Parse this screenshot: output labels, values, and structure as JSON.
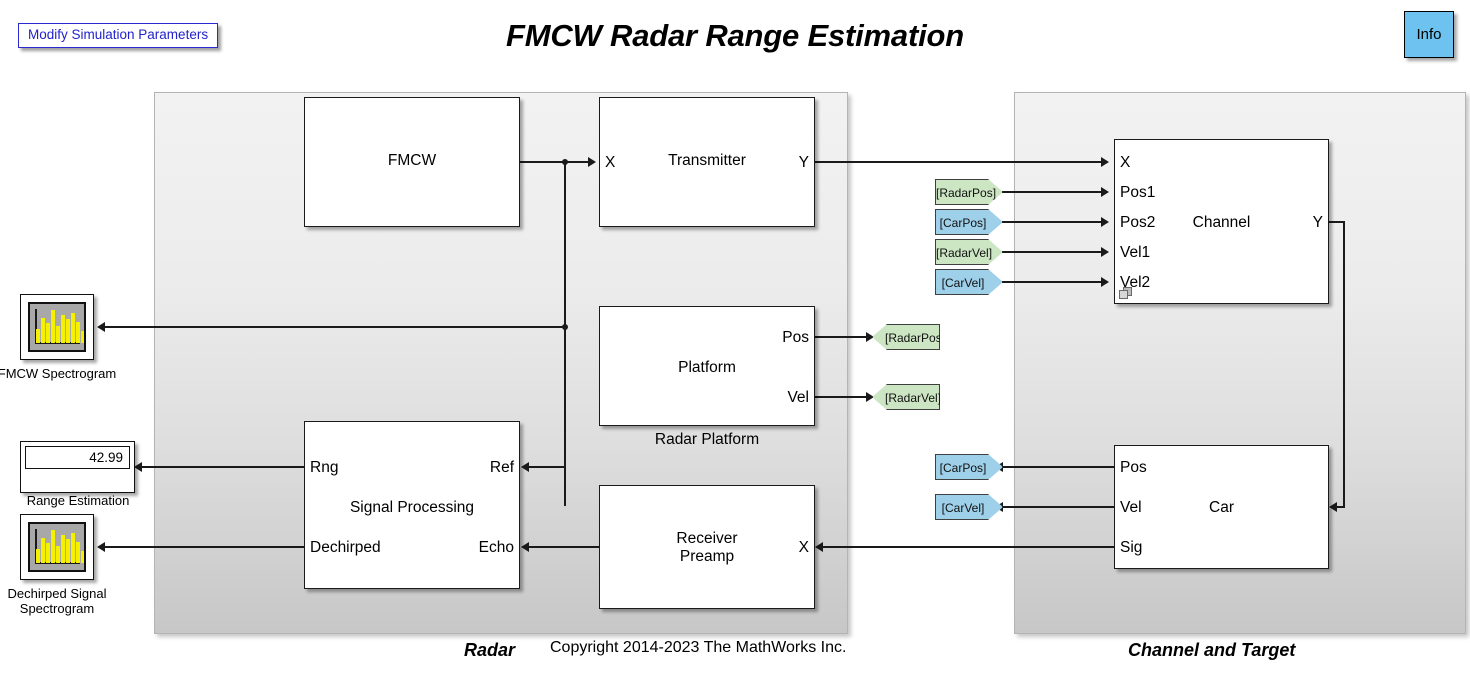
{
  "header": {
    "title": "FMCW Radar Range Estimation",
    "modify_button": "Modify Simulation Parameters",
    "info_button": "Info"
  },
  "footer": {
    "copyright": "Copyright 2014-2023 The MathWorks Inc."
  },
  "subsystems": [
    {
      "label": "Radar"
    },
    {
      "label": "Channel and Target"
    }
  ],
  "radar": {
    "fmcw": {
      "title": "FMCW"
    },
    "transmitter": {
      "title": "Transmitter",
      "in": "X",
      "out": "Y"
    },
    "platform": {
      "title": "Platform",
      "caption": "Radar Platform",
      "out_pos": "Pos",
      "out_vel": "Vel"
    },
    "signal_processing": {
      "title": "Signal Processing",
      "out_rng": "Rng",
      "out_dechirped": "Dechirped",
      "in_ref": "Ref",
      "in_echo": "Echo"
    },
    "receiver": {
      "title": "Receiver\nPreamp",
      "in": "X"
    }
  },
  "channel_target": {
    "channel": {
      "title": "Channel",
      "in_x": "X",
      "in_pos1": "Pos1",
      "in_pos2": "Pos2",
      "in_vel1": "Vel1",
      "in_vel2": "Vel2",
      "out_y": "Y"
    },
    "car": {
      "title": "Car",
      "out_pos": "Pos",
      "out_vel": "Vel",
      "out_sig": "Sig"
    }
  },
  "tags": {
    "radar_pos_from": "[RadarPos]",
    "car_pos_from": "[CarPos]",
    "radar_vel_from": "[RadarVel]",
    "car_vel_from": "[CarVel]",
    "radar_pos_goto": "[RadarPos]",
    "radar_vel_goto": "[RadarVel]",
    "car_pos_goto": "[CarPos]",
    "car_vel_goto": "[CarVel]"
  },
  "sinks": {
    "fmcw_spectrogram": {
      "caption": "FMCW Spectrogram"
    },
    "range_estimation": {
      "caption": "Range Estimation",
      "value": "42.99"
    },
    "dechirped_spectrogram": {
      "caption": "Dechirped Signal\nSpectrogram"
    }
  },
  "colors": {
    "accent_blue": "#2222cc",
    "info_bg": "#6ec2ef",
    "tag_green": "#cce6c3",
    "tag_blue": "#9ed0ea",
    "scope_trace": "#f5f000"
  }
}
